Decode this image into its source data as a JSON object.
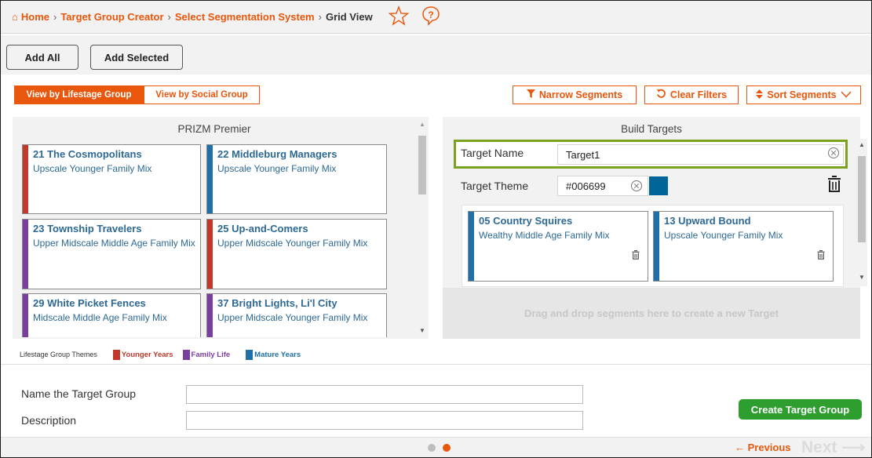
{
  "breadcrumb": {
    "home": "Home",
    "creator": "Target Group Creator",
    "system": "Select Segmentation System",
    "current": "Grid View",
    "separator": "›"
  },
  "toolbar": {
    "add_all": "Add All",
    "add_selected": "Add Selected"
  },
  "view_tabs": {
    "lifestage": "View by Lifestage Group",
    "social": "View by Social Group"
  },
  "filters": {
    "narrow": "Narrow Segments",
    "clear": "Clear Filters",
    "sort": "Sort Segments"
  },
  "left_panel": {
    "title": "PRIZM Premier",
    "cards": [
      {
        "title": "21 The Cosmopolitans",
        "subtitle": "Upscale Younger Family Mix",
        "color": "#c0392b"
      },
      {
        "title": "22 Middleburg Managers",
        "subtitle": "Upscale Younger Family Mix",
        "color": "#1f6fa8"
      },
      {
        "title": "23 Township Travelers",
        "subtitle": "Upper Midscale Middle Age Family Mix",
        "color": "#7a3ea1"
      },
      {
        "title": "25 Up-and-Comers",
        "subtitle": "Upper Midscale Younger Family Mix",
        "color": "#c0392b"
      },
      {
        "title": "29 White Picket Fences",
        "subtitle": "Midscale Middle Age Family Mix",
        "color": "#7a3ea1"
      },
      {
        "title": "37 Bright Lights, Li'l City",
        "subtitle": "Upper Midscale Younger Family Mix",
        "color": "#7a3ea1"
      }
    ]
  },
  "legend": {
    "label": "Lifestage Group Themes",
    "items": [
      {
        "label": "Younger Years",
        "color": "#c0392b"
      },
      {
        "label": "Family Life",
        "color": "#7a3ea1"
      },
      {
        "label": "Mature Years",
        "color": "#1f6fa8"
      }
    ]
  },
  "right_panel": {
    "title": "Build Targets",
    "target_name_label": "Target Name",
    "target_name_value": "Target1",
    "target_theme_label": "Target Theme",
    "target_theme_value": "#006699",
    "theme_color": "#006699",
    "cards": [
      {
        "title": "05 Country Squires",
        "subtitle": "Wealthy Middle Age Family Mix",
        "color": "#1f6fa8"
      },
      {
        "title": "13 Upward Bound",
        "subtitle": "Upscale Younger Family Mix",
        "color": "#1f6fa8"
      }
    ],
    "drop_hint": "Drag and drop segments here to create a new Target"
  },
  "form": {
    "name_label": "Name the Target Group",
    "name_value": "",
    "description_label": "Description",
    "description_value": "",
    "create_button": "Create Target Group"
  },
  "pager": {
    "previous": "← Previous",
    "next": "Next ⟶",
    "dots": 2,
    "active_dot": 2
  },
  "colors": {
    "accent": "#e8570c",
    "success": "#2e9e2e",
    "highlight_border": "#7aa21c"
  }
}
